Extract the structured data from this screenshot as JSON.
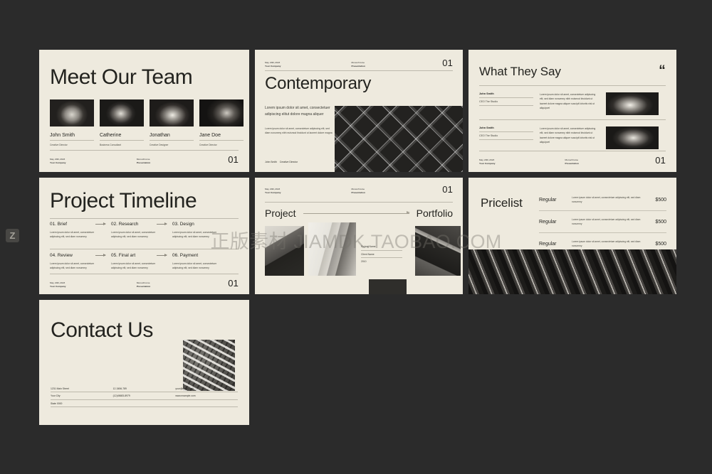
{
  "canvas": {
    "background": "#2b2b2b",
    "slide_background": "#eeeade",
    "ink": "#23231f"
  },
  "meta": {
    "date": "May 20th,2023",
    "company": "Your Company",
    "brand": "Monochrome",
    "kind": "Presentation",
    "page": "01"
  },
  "watermark": {
    "text": "正版素材 JIAMDK.TAOBAO.COM",
    "badge": "Z"
  },
  "slides": {
    "team": {
      "title": "Meet Our Team",
      "members": [
        {
          "name": "John Smith",
          "role": "Creative Director",
          "photo": "portrait-man-1"
        },
        {
          "name": "Catherine",
          "role": "Business Consultant",
          "photo": "portrait-woman-1"
        },
        {
          "name": "Jonathan",
          "role": "Creative Designer",
          "photo": "portrait-man-2"
        },
        {
          "name": "Jane Doe",
          "role": "Creative Director",
          "photo": "portrait-man-3"
        }
      ]
    },
    "contemporary": {
      "title": "Contemporary",
      "lead": "Lorem ipsum dolor sit amet, consectetuer adipiscing elitut dolore magna aliquer",
      "body": "Lorem ipsum dolor sit amet, consectetuer adipiscing elit, sed diam nonummy nibh euismod tincidunt ut laoreet dolore magna",
      "credit_name": "John Smith",
      "credit_role": "Creative Director",
      "image": "chevron-pattern"
    },
    "testimonials": {
      "title": "What They Say",
      "quote_mark": "“",
      "items": [
        {
          "name": "John Smith",
          "role": "CEO The Studio",
          "text": "Lorem ipsum dolor sit amet, consectetuer adipiscing elit, sed diam nonummy nibh euismod tincidunt ut laoreet dolore magna aliquer suscipit lobortis nisl ut aliquipvel",
          "photo": "portrait-man-laughing"
        },
        {
          "name": "John Smith",
          "role": "CEO The Studio",
          "text": "Lorem ipsum dolor sit amet, consectetuer adipiscing elit, sed diam nonummy nibh euismod tincidunt ut laoreet dolore magna aliquer suscipit lobortis nisl ut aliquipvel",
          "photo": "portrait-woman-smiling"
        }
      ]
    },
    "timeline": {
      "title": "Project Timeline",
      "steps": [
        {
          "label": "01. Brief",
          "desc": "Lorem ipsum dolor sit amet, consectetuer adipiscing elit, sed diam nonummy"
        },
        {
          "label": "02. Research",
          "desc": "Lorem ipsum dolor sit amet, consectetuer adipiscing elit, sed diam nonummy"
        },
        {
          "label": "03. Design",
          "desc": "Lorem ipsum dolor sit amet, consectetuer adipiscing elit, sed diam nonummy"
        },
        {
          "label": "04. Review",
          "desc": "Lorem ipsum dolor sit amet, consectetuer adipiscing elit, sed diam nonummy"
        },
        {
          "label": "05. Final art",
          "desc": "Lorem ipsum dolor sit amet, consectetuer adipiscing elit, sed diam nonummy"
        },
        {
          "label": "06. Payment",
          "desc": "Lorem ipsum dolor sit amet, consectetuer adipiscing elit, sed diam nonummy"
        }
      ]
    },
    "portfolio": {
      "title_left": "Project",
      "title_right": "Portfolio",
      "details": [
        "Project Name",
        "Client Name",
        "2010"
      ],
      "images": [
        "architecture-1",
        "architecture-2",
        "architecture-3"
      ]
    },
    "pricelist": {
      "title": "Pricelist",
      "rows": [
        {
          "name": "Regular",
          "desc": "Lorem ipsum dolor sit amet, consectetuer adipiscing elit, sed diam nonummy",
          "price": "$500"
        },
        {
          "name": "Regular",
          "desc": "Lorem ipsum dolor sit amet, consectetuer adipiscing elit, sed diam nonummy",
          "price": "$500"
        },
        {
          "name": "Regular",
          "desc": "Lorem ipsum dolor sit amet, consectetuer adipiscing elit, sed diam nonummy",
          "price": "$500"
        }
      ],
      "image": "diagonal-stripe-pattern"
    },
    "contact": {
      "title": "Contact Us",
      "address": [
        "1231 Main Street",
        "Your City",
        "State 0000"
      ],
      "phones": [
        "12-3456-789",
        "(12)45683-8979"
      ],
      "web": [
        "your@email.com",
        "www.example.com"
      ],
      "image": "crosswalk-aerial"
    }
  }
}
